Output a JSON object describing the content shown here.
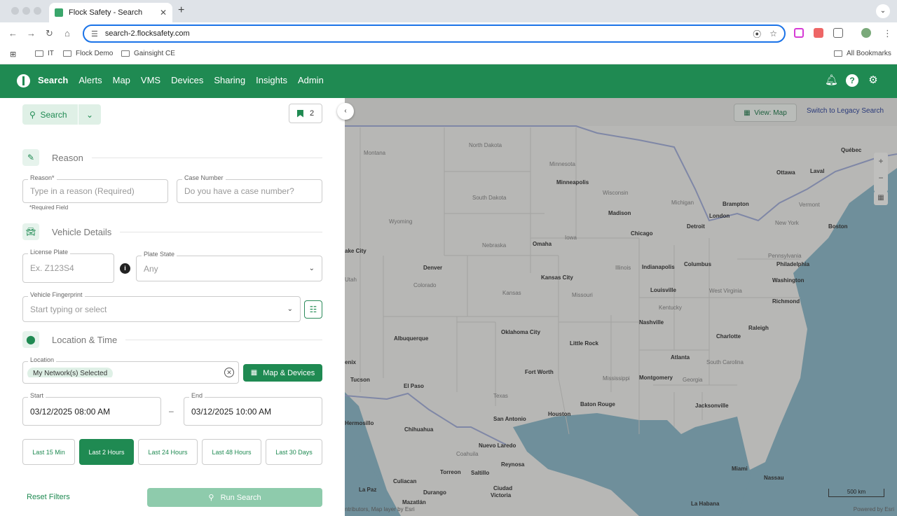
{
  "browser": {
    "tab_title": "Flock Safety - Search",
    "url": "search-2.flocksafety.com",
    "bookmarks": [
      "IT",
      "Flock Demo",
      "Gainsight CE"
    ],
    "all_bookmarks": "All Bookmarks"
  },
  "app": {
    "nav": [
      "Search",
      "Alerts",
      "Map",
      "VMS",
      "Devices",
      "Sharing",
      "Insights",
      "Admin"
    ],
    "active_nav": "Search"
  },
  "panel": {
    "search_label": "Search",
    "bookmark_count": "2",
    "reason_section": "Reason",
    "reason_label": "Reason*",
    "reason_placeholder": "Type in a reason (Required)",
    "required_note": "*Required Field",
    "case_label": "Case Number",
    "case_placeholder": "Do you have a case number?",
    "vehicle_section": "Vehicle Details",
    "plate_label": "License Plate",
    "plate_placeholder": "Ex. Z123S4",
    "plate_state_label": "Plate State",
    "plate_state_value": "Any",
    "fingerprint_label": "Vehicle Fingerprint",
    "fingerprint_placeholder": "Start typing or select",
    "location_section": "Location & Time",
    "location_label": "Location",
    "location_chip": "My Network(s) Selected",
    "map_devices": "Map & Devices",
    "start_label": "Start",
    "start_value": "03/12/2025 08:00 AM",
    "end_label": "End",
    "end_value": "03/12/2025 10:00 AM",
    "dash": "–",
    "quick_ranges": [
      "Last 15 Min",
      "Last 2 Hours",
      "Last 24 Hours",
      "Last 48 Hours",
      "Last 30 Days"
    ],
    "active_range": "Last 2 Hours",
    "reset": "Reset Filters",
    "run": "Run Search"
  },
  "map": {
    "view_map": "View: Map",
    "legacy": "Switch to Legacy Search",
    "scale": "500 km",
    "attribution_left": "ntributors, Map layer by Esri",
    "attribution_right": "Powered by Esri",
    "labels": [
      {
        "t": "North Dakota",
        "k": "state"
      },
      {
        "t": "Montana",
        "k": "state"
      },
      {
        "t": "Minnesota",
        "k": "state"
      },
      {
        "t": "Québec",
        "k": "city"
      },
      {
        "t": "Ottawa",
        "k": "city"
      },
      {
        "t": "Laval",
        "k": "city"
      },
      {
        "t": "Minneapolis",
        "k": "city"
      },
      {
        "t": "Wisconsin",
        "k": "state"
      },
      {
        "t": "South Dakota",
        "k": "state"
      },
      {
        "t": "Michigan",
        "k": "state"
      },
      {
        "t": "Brampton",
        "k": "city"
      },
      {
        "t": "Vermont",
        "k": "state"
      },
      {
        "t": "Madison",
        "k": "city"
      },
      {
        "t": "London",
        "k": "city"
      },
      {
        "t": "Wyoming",
        "k": "state"
      },
      {
        "t": "Detroit",
        "k": "city"
      },
      {
        "t": "New York",
        "k": "state"
      },
      {
        "t": "Boston",
        "k": "city"
      },
      {
        "t": "Iowa",
        "k": "state"
      },
      {
        "t": "Chicago",
        "k": "city"
      },
      {
        "t": "Omaha",
        "k": "city"
      },
      {
        "t": "Nebraska",
        "k": "state"
      },
      {
        "t": "ake City",
        "k": "city"
      },
      {
        "t": "Pennsylvania",
        "k": "state"
      },
      {
        "t": "Columbus",
        "k": "city"
      },
      {
        "t": "Philadelphia",
        "k": "city"
      },
      {
        "t": "Denver",
        "k": "city"
      },
      {
        "t": "Illinois",
        "k": "state"
      },
      {
        "t": "Indianapolis",
        "k": "city"
      },
      {
        "t": "Kansas City",
        "k": "city"
      },
      {
        "t": "Utah",
        "k": "state"
      },
      {
        "t": "Washington",
        "k": "city"
      },
      {
        "t": "Colorado",
        "k": "state"
      },
      {
        "t": "Louisville",
        "k": "city"
      },
      {
        "t": "West Virginia",
        "k": "state"
      },
      {
        "t": "Kansas",
        "k": "state"
      },
      {
        "t": "Missouri",
        "k": "state"
      },
      {
        "t": "Richmond",
        "k": "city"
      },
      {
        "t": "Kentucky",
        "k": "state"
      },
      {
        "t": "Nashville",
        "k": "city"
      },
      {
        "t": "Raleigh",
        "k": "city"
      },
      {
        "t": "Oklahoma City",
        "k": "city"
      },
      {
        "t": "Charlotte",
        "k": "city"
      },
      {
        "t": "Albuquerque",
        "k": "city"
      },
      {
        "t": "Little Rock",
        "k": "city"
      },
      {
        "t": "Atlanta",
        "k": "city"
      },
      {
        "t": "enix",
        "k": "city"
      },
      {
        "t": "South Carolina",
        "k": "state"
      },
      {
        "t": "Fort Worth",
        "k": "city"
      },
      {
        "t": "Tucson",
        "k": "city"
      },
      {
        "t": "Mississippi",
        "k": "state"
      },
      {
        "t": "Montgomery",
        "k": "city"
      },
      {
        "t": "Georgia",
        "k": "state"
      },
      {
        "t": "El Paso",
        "k": "city"
      },
      {
        "t": "Texas",
        "k": "state"
      },
      {
        "t": "Baton Rouge",
        "k": "city"
      },
      {
        "t": "Jacksonville",
        "k": "city"
      },
      {
        "t": "Houston",
        "k": "city"
      },
      {
        "t": "San Antonio",
        "k": "city"
      },
      {
        "t": "Hermosillo",
        "k": "city"
      },
      {
        "t": "Chihuahua",
        "k": "city"
      },
      {
        "t": "Nuevo Laredo",
        "k": "city"
      },
      {
        "t": "Coahuila",
        "k": "state"
      },
      {
        "t": "Reynosa",
        "k": "city"
      },
      {
        "t": "Torreon",
        "k": "city"
      },
      {
        "t": "Saltillo",
        "k": "city"
      },
      {
        "t": "Miami",
        "k": "city"
      },
      {
        "t": "Culiacan",
        "k": "city"
      },
      {
        "t": "Nassau",
        "k": "city"
      },
      {
        "t": "La Paz",
        "k": "city"
      },
      {
        "t": "Durango",
        "k": "city"
      },
      {
        "t": "Ciudad",
        "k": "city"
      },
      {
        "t": "Victoria",
        "k": "city"
      },
      {
        "t": "Mazatlán",
        "k": "city"
      },
      {
        "t": "La Habana",
        "k": "city"
      }
    ]
  }
}
